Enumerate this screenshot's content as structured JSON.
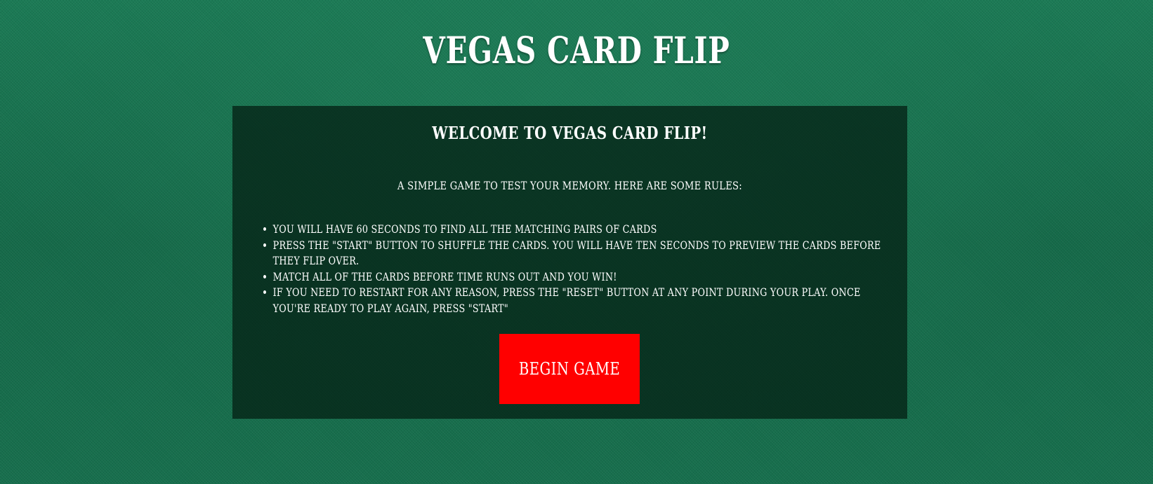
{
  "app": {
    "title": "Vegas Card Flip"
  },
  "panel": {
    "heading": "Welcome to Vegas Card Flip!",
    "intro": "A simple game to test your memory. Here are some rules:",
    "rules": [
      "You will have 60 seconds to find all the matching pairs of cards",
      "Press the \"Start\" button to shuffle the cards. You will have ten seconds to preview the cards before they flip over.",
      "Match all of the cards before time runs out and you win!",
      "If you need to restart for any reason, press the \"Reset\" button at any point during your play. Once you're ready to play again, press \"Start\""
    ],
    "begin_label": "Begin Game"
  },
  "colors": {
    "felt": "#176b4b",
    "panel": "#06241a",
    "button": "#ff0000",
    "text": "#ffffff"
  }
}
